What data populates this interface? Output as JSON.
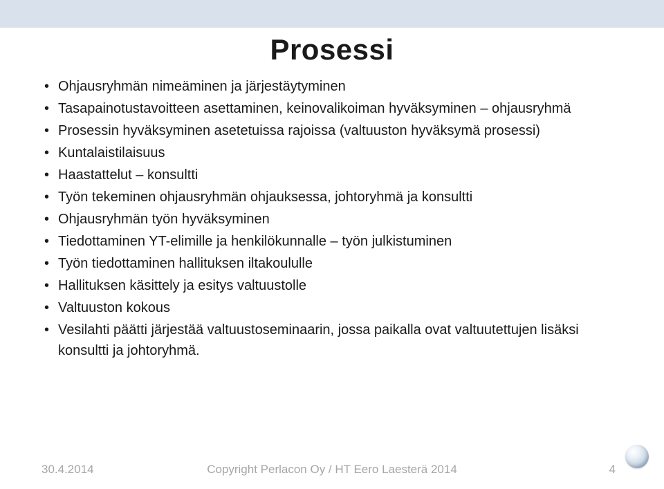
{
  "title": "Prosessi",
  "bullets": [
    "Ohjausryhmän nimeäminen ja järjestäytyminen",
    "Tasapainotustavoitteen asettaminen, keinovalikoiman hyväksyminen – ohjausryhmä",
    "Prosessin hyväksyminen asetetuissa rajoissa (valtuuston hyväksymä prosessi)",
    "Kuntalaistilaisuus",
    "Haastattelut – konsultti",
    "Työn tekeminen ohjausryhmän ohjauksessa, johtoryhmä ja konsultti",
    "Ohjausryhmän työn hyväksyminen",
    "Tiedottaminen YT-elimille ja henkilökunnalle – työn julkistuminen",
    "Työn tiedottaminen hallituksen iltakoululle",
    "Hallituksen käsittely ja esitys valtuustolle",
    "Valtuuston kokous",
    "Vesilahti päätti järjestää valtuustoseminaarin, jossa paikalla ovat valtuutettujen lisäksi konsultti ja johtoryhmä."
  ],
  "footer": {
    "date": "30.4.2014",
    "copyright": "Copyright Perlacon Oy / HT Eero Laesterä 2014",
    "page": "4"
  }
}
